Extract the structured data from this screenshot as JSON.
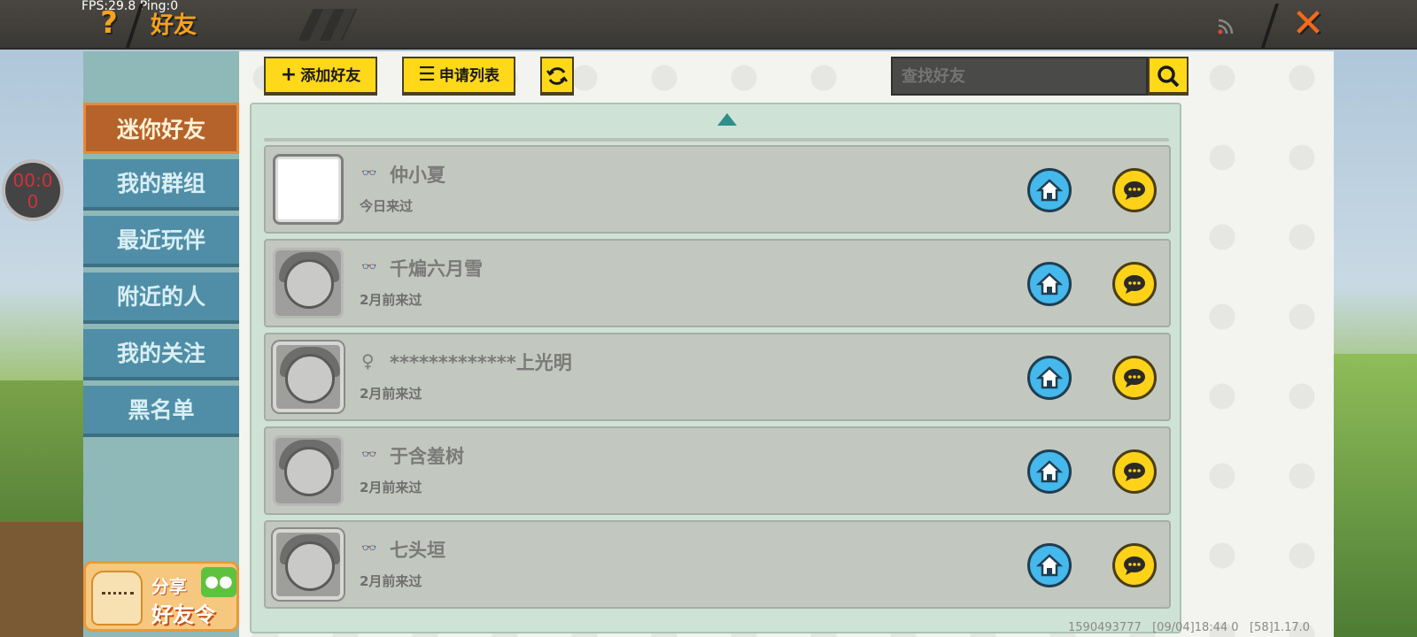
{
  "overlay": {
    "fps_text": "FPS:29.8  Ping:0",
    "timer_line1": "00:0",
    "timer_line2": "0"
  },
  "header": {
    "help_label": "?",
    "title": "好友",
    "close_label": "✕"
  },
  "sidebar": {
    "items": [
      {
        "label": "迷你好友",
        "active": true
      },
      {
        "label": "我的群组"
      },
      {
        "label": "最近玩伴"
      },
      {
        "label": "附近的人"
      },
      {
        "label": "我的关注"
      },
      {
        "label": "黑名单"
      }
    ],
    "share": {
      "line1": "分享",
      "line2": "好友令"
    }
  },
  "toolbar": {
    "add_friend_label": "添加好友",
    "request_list_label": "申请列表",
    "search_placeholder": "查找好友"
  },
  "friends": [
    {
      "gender_icon": "mask-icon",
      "gender_text": "👓",
      "name": "仲小夏",
      "last_seen": "今日来过",
      "avatar": "blank"
    },
    {
      "gender_icon": "mask-icon",
      "gender_text": "👓",
      "name": "千煸六月雪",
      "last_seen": "2月前来过",
      "avatar": "portrait"
    },
    {
      "gender_icon": "female-icon",
      "gender_text": "♀",
      "name": "*************上光明",
      "last_seen": "2月前来过",
      "avatar": "framed"
    },
    {
      "gender_icon": "mask-icon",
      "gender_text": "👓",
      "name": "于含羞树",
      "last_seen": "2月前来过",
      "avatar": "portrait"
    },
    {
      "gender_icon": "mask-icon",
      "gender_text": "👓",
      "name": "七头垣",
      "last_seen": "2月前来过",
      "avatar": "framed"
    }
  ],
  "footer": {
    "version_text": "1590493777   [09/04]18:44 0   [58]1.17.0"
  },
  "colors": {
    "accent_yellow": "#ffd81a",
    "nav_blue": "#4f8ea6",
    "nav_active": "#b5632a",
    "home_blue": "#45b8ec",
    "title_orange": "#f5a21c"
  }
}
